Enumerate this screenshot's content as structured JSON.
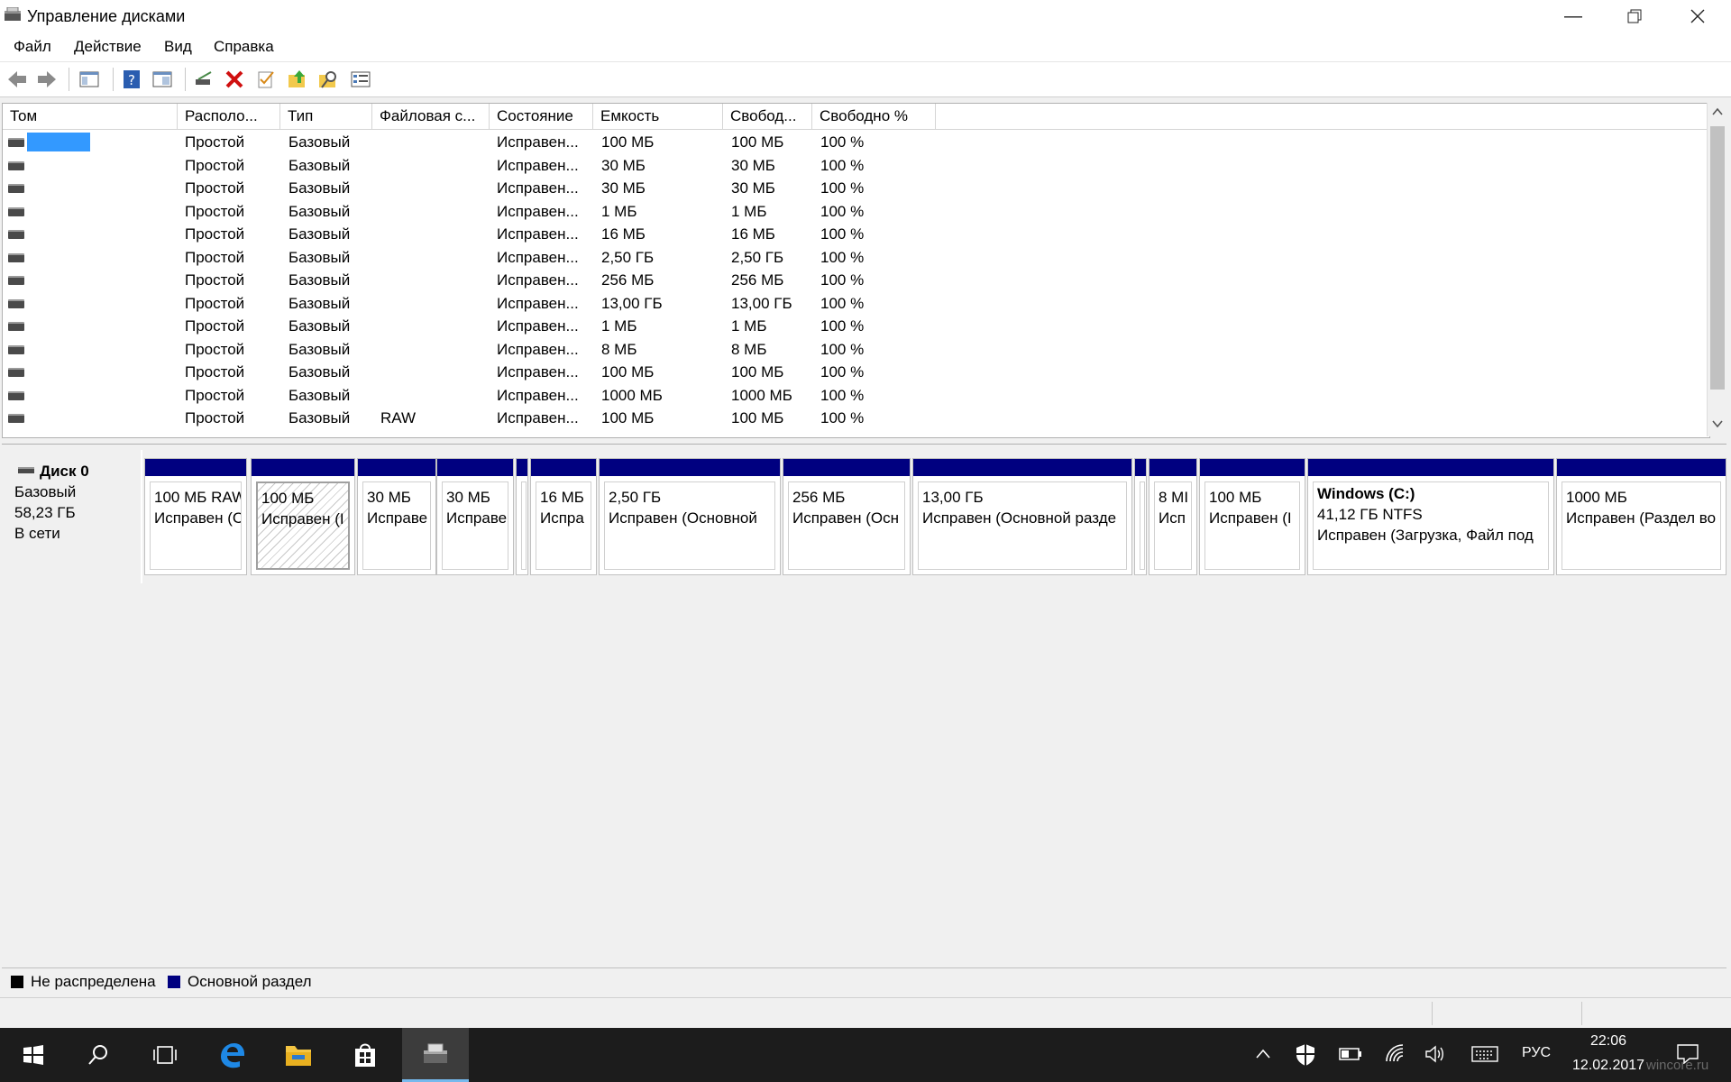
{
  "window": {
    "title": "Управление дисками"
  },
  "menu": [
    "Файл",
    "Действие",
    "Вид",
    "Справка"
  ],
  "toolbar": [
    "back-icon",
    "forward-icon",
    "console-tree-icon",
    "help-icon",
    "view-icon",
    "connect-icon",
    "delete-icon",
    "properties-check-icon",
    "upload-folder-icon",
    "search-folder-icon",
    "list-view-icon"
  ],
  "columns": [
    "Том",
    "Располо...",
    "Тип",
    "Файловая с...",
    "Состояние",
    "Емкость",
    "Свобод...",
    "Свободно %"
  ],
  "volumes": [
    [
      "",
      "Простой",
      "Базовый",
      "",
      "Исправен...",
      "100 МБ",
      "100 МБ",
      "100 %"
    ],
    [
      "",
      "Простой",
      "Базовый",
      "",
      "Исправен...",
      "30 МБ",
      "30 МБ",
      "100 %"
    ],
    [
      "",
      "Простой",
      "Базовый",
      "",
      "Исправен...",
      "30 МБ",
      "30 МБ",
      "100 %"
    ],
    [
      "",
      "Простой",
      "Базовый",
      "",
      "Исправен...",
      "1 МБ",
      "1 МБ",
      "100 %"
    ],
    [
      "",
      "Простой",
      "Базовый",
      "",
      "Исправен...",
      "16 МБ",
      "16 МБ",
      "100 %"
    ],
    [
      "",
      "Простой",
      "Базовый",
      "",
      "Исправен...",
      "2,50 ГБ",
      "2,50 ГБ",
      "100 %"
    ],
    [
      "",
      "Простой",
      "Базовый",
      "",
      "Исправен...",
      "256 МБ",
      "256 МБ",
      "100 %"
    ],
    [
      "",
      "Простой",
      "Базовый",
      "",
      "Исправен...",
      "13,00 ГБ",
      "13,00 ГБ",
      "100 %"
    ],
    [
      "",
      "Простой",
      "Базовый",
      "",
      "Исправен...",
      "1 МБ",
      "1 МБ",
      "100 %"
    ],
    [
      "",
      "Простой",
      "Базовый",
      "",
      "Исправен...",
      "8 МБ",
      "8 МБ",
      "100 %"
    ],
    [
      "",
      "Простой",
      "Базовый",
      "",
      "Исправен...",
      "100 МБ",
      "100 МБ",
      "100 %"
    ],
    [
      "",
      "Простой",
      "Базовый",
      "",
      "Исправен...",
      "1000 МБ",
      "1000 МБ",
      "100 %"
    ],
    [
      "",
      "Простой",
      "Базовый",
      "RAW",
      "Исправен...",
      "100 МБ",
      "100 МБ",
      "100 %"
    ]
  ],
  "disk": {
    "name": "Диск 0",
    "type": "Базовый",
    "size": "58,23 ГБ",
    "status": "В сети"
  },
  "partitions": [
    {
      "title": "",
      "line1": "100 МБ RAW",
      "line2": "Исправен (С"
    },
    {
      "title": "",
      "line1": "100 МБ",
      "line2": "Исправен (I"
    },
    {
      "title": "",
      "line1": "30 МБ",
      "line2": "Исправе"
    },
    {
      "title": "",
      "line1": "30 МБ",
      "line2": "Исправе"
    },
    {
      "title": "",
      "line1": "",
      "line2": ""
    },
    {
      "title": "",
      "line1": "16 МБ",
      "line2": "Испра"
    },
    {
      "title": "",
      "line1": "2,50 ГБ",
      "line2": "Исправен (Основной"
    },
    {
      "title": "",
      "line1": "256 МБ",
      "line2": "Исправен (Осн"
    },
    {
      "title": "",
      "line1": "13,00 ГБ",
      "line2": "Исправен (Основной разде"
    },
    {
      "title": "",
      "line1": "",
      "line2": ""
    },
    {
      "title": "",
      "line1": "8 МІ",
      "line2": "Исп"
    },
    {
      "title": "",
      "line1": "100 МБ",
      "line2": "Исправен (I"
    },
    {
      "title": "Windows  (C:)",
      "line1": "41,12 ГБ NTFS",
      "line2": "Исправен (Загрузка, Файл под"
    },
    {
      "title": "",
      "line1": "1000 МБ",
      "line2": "Исправен (Раздел во"
    }
  ],
  "legend": [
    {
      "label": "Не распределена",
      "color": "#000000"
    },
    {
      "label": "Основной раздел",
      "color": "#000080"
    }
  ],
  "taskbar": {
    "apps": [
      "start-icon",
      "search-icon",
      "task-view-icon",
      "edge-icon",
      "explorer-icon",
      "store-icon",
      "disk-management-icon"
    ],
    "tray": [
      "chevron-up-icon",
      "defender-icon",
      "battery-icon",
      "wifi-icon",
      "volume-icon",
      "keyboard-icon"
    ],
    "language": "РУС",
    "time": "22:06",
    "date": "12.02.2017",
    "watermark": "wincore.ru"
  }
}
